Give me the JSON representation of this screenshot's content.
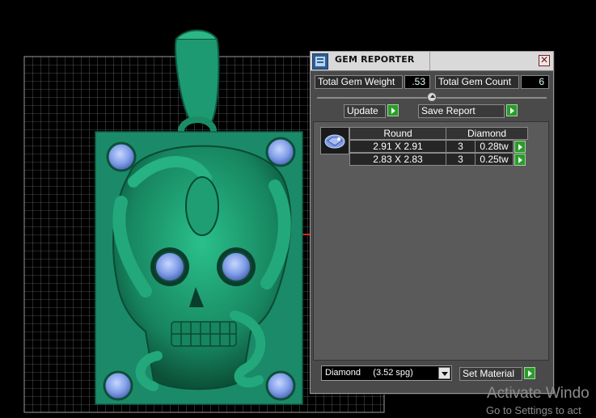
{
  "panel": {
    "title": "GEM REPORTER",
    "close_symbol": "✕",
    "total_gem_weight_label": "Total Gem Weight",
    "total_gem_weight_value": ".53",
    "total_gem_count_label": "Total Gem Count",
    "total_gem_count_value": "6",
    "update_label": "Update",
    "save_report_label": "Save Report",
    "table": {
      "headers": [
        "Round",
        "Diamond"
      ],
      "rows": [
        {
          "size": "2.91 X 2.91",
          "count": "3",
          "weight": "0.28tw"
        },
        {
          "size": "2.83 X 2.83",
          "count": "3",
          "weight": "0.25tw"
        }
      ]
    },
    "material_select_value": "Diamond     (3.52 spg)",
    "set_material_label": "Set Material"
  },
  "watermark": {
    "title": "Activate Windo",
    "subtitle": "Go to Settings to act"
  },
  "colors": {
    "panel_bg": "#4a4a4a",
    "go_green": "#2c9a2c",
    "model_green": "#1e9a72",
    "plate_green": "#1b8a68",
    "gem_blue": "#7f9de6"
  },
  "icons": {
    "title_icon": "gem-reporter-app-icon",
    "close": "close-icon",
    "go": "play-arrow-icon",
    "dropdown": "chevron-down-icon",
    "thumb": "round-gem-icon"
  }
}
